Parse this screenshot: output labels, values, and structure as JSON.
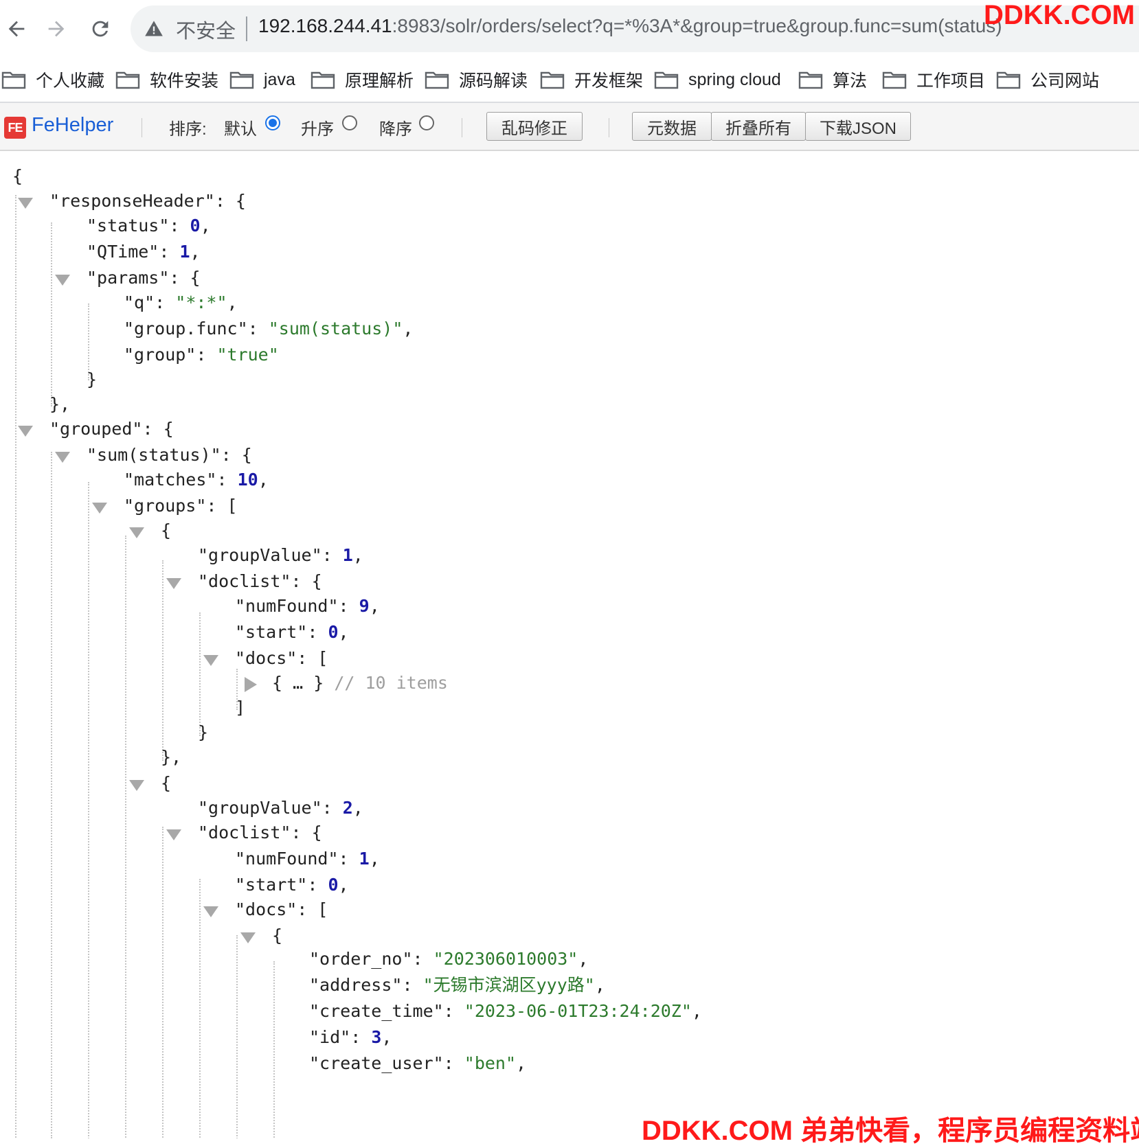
{
  "browser": {
    "security_label": "不安全",
    "url_host": "192.168.244.41",
    "url_rest": ":8983/solr/orders/select?q=*%3A*&group=true&group.func=sum(status)",
    "watermark_top": "DDKK.COM"
  },
  "bookmarks": [
    {
      "label": "个人收藏"
    },
    {
      "label": "软件安装"
    },
    {
      "label": "java"
    },
    {
      "label": "原理解析"
    },
    {
      "label": "源码解读"
    },
    {
      "label": "开发框架"
    },
    {
      "label": "spring cloud"
    },
    {
      "label": "算法"
    },
    {
      "label": "工作项目"
    },
    {
      "label": "公司网站"
    }
  ],
  "fehelper": {
    "name": "FeHelper",
    "logo_text": "FE",
    "sort_label": "排序:",
    "sort_options": [
      {
        "label": "默认",
        "selected": true
      },
      {
        "label": "升序",
        "selected": false
      },
      {
        "label": "降序",
        "selected": false
      }
    ],
    "buttons": {
      "fix_encoding": "乱码修正",
      "metadata": "元数据",
      "collapse_all": "折叠所有",
      "download_json": "下载JSON"
    }
  },
  "json_lines": [
    {
      "parts": [
        [
          "p",
          "{"
        ]
      ]
    },
    {
      "parts": [
        [
          "p",
          "\"responseHeader\": {"
        ]
      ]
    },
    {
      "parts": [
        [
          "p",
          "\"status\": "
        ],
        [
          "n",
          "0"
        ],
        [
          "p",
          ","
        ]
      ]
    },
    {
      "parts": [
        [
          "p",
          "\"QTime\": "
        ],
        [
          "n",
          "1"
        ],
        [
          "p",
          ","
        ]
      ]
    },
    {
      "parts": [
        [
          "p",
          "\"params\": {"
        ]
      ]
    },
    {
      "parts": [
        [
          "p",
          "\"q\": "
        ],
        [
          "s",
          "\"*:*\""
        ],
        [
          "p",
          ","
        ]
      ]
    },
    {
      "parts": [
        [
          "p",
          "\"group.func\": "
        ],
        [
          "s",
          "\"sum(status)\""
        ],
        [
          "p",
          ","
        ]
      ]
    },
    {
      "parts": [
        [
          "p",
          "\"group\": "
        ],
        [
          "s",
          "\"true\""
        ]
      ]
    },
    {
      "parts": [
        [
          "p",
          "}"
        ]
      ]
    },
    {
      "parts": [
        [
          "p",
          "},"
        ]
      ]
    },
    {
      "parts": [
        [
          "p",
          "\"grouped\": {"
        ]
      ]
    },
    {
      "parts": [
        [
          "p",
          "\"sum(status)\": {"
        ]
      ]
    },
    {
      "parts": [
        [
          "p",
          "\"matches\": "
        ],
        [
          "n",
          "10"
        ],
        [
          "p",
          ","
        ]
      ]
    },
    {
      "parts": [
        [
          "p",
          "\"groups\": ["
        ]
      ]
    },
    {
      "parts": [
        [
          "p",
          "{"
        ]
      ]
    },
    {
      "parts": [
        [
          "p",
          "\"groupValue\": "
        ],
        [
          "n",
          "1"
        ],
        [
          "p",
          ","
        ]
      ]
    },
    {
      "parts": [
        [
          "p",
          "\"doclist\": {"
        ]
      ]
    },
    {
      "parts": [
        [
          "p",
          "\"numFound\": "
        ],
        [
          "n",
          "9"
        ],
        [
          "p",
          ","
        ]
      ]
    },
    {
      "parts": [
        [
          "p",
          "\"start\": "
        ],
        [
          "n",
          "0"
        ],
        [
          "p",
          ","
        ]
      ]
    },
    {
      "parts": [
        [
          "p",
          "\"docs\": ["
        ]
      ]
    },
    {
      "parts": [
        [
          "p",
          "{ … } "
        ],
        [
          "c",
          "// 10 items"
        ]
      ]
    },
    {
      "parts": [
        [
          "p",
          "]"
        ]
      ]
    },
    {
      "parts": [
        [
          "p",
          "}"
        ]
      ]
    },
    {
      "parts": [
        [
          "p",
          "},"
        ]
      ]
    },
    {
      "parts": [
        [
          "p",
          "{"
        ]
      ]
    },
    {
      "parts": [
        [
          "p",
          "\"groupValue\": "
        ],
        [
          "n",
          "2"
        ],
        [
          "p",
          ","
        ]
      ]
    },
    {
      "parts": [
        [
          "p",
          "\"doclist\": {"
        ]
      ]
    },
    {
      "parts": [
        [
          "p",
          "\"numFound\": "
        ],
        [
          "n",
          "1"
        ],
        [
          "p",
          ","
        ]
      ]
    },
    {
      "parts": [
        [
          "p",
          "\"start\": "
        ],
        [
          "n",
          "0"
        ],
        [
          "p",
          ","
        ]
      ]
    },
    {
      "parts": [
        [
          "p",
          "\"docs\": ["
        ]
      ]
    },
    {
      "parts": [
        [
          "p",
          "{"
        ]
      ]
    },
    {
      "parts": [
        [
          "p",
          "\"order_no\": "
        ],
        [
          "s",
          "\"202306010003\""
        ],
        [
          "p",
          ","
        ]
      ]
    },
    {
      "parts": [
        [
          "p",
          "\"address\": "
        ],
        [
          "s",
          "\"无锡市滨湖区yyy路\""
        ],
        [
          "p",
          ","
        ]
      ]
    },
    {
      "parts": [
        [
          "p",
          "\"create_time\": "
        ],
        [
          "s",
          "\"2023-06-01T23:24:20Z\""
        ],
        [
          "p",
          ","
        ]
      ]
    },
    {
      "parts": [
        [
          "p",
          "\"id\": "
        ],
        [
          "n",
          "3"
        ],
        [
          "p",
          ","
        ]
      ]
    },
    {
      "parts": [
        [
          "p",
          "\"create_user\": "
        ],
        [
          "s",
          "\"ben\""
        ],
        [
          "p",
          ","
        ]
      ]
    }
  ],
  "watermark_bottom": "DDKK.COM 弟弟快看，程序员编程资料站"
}
